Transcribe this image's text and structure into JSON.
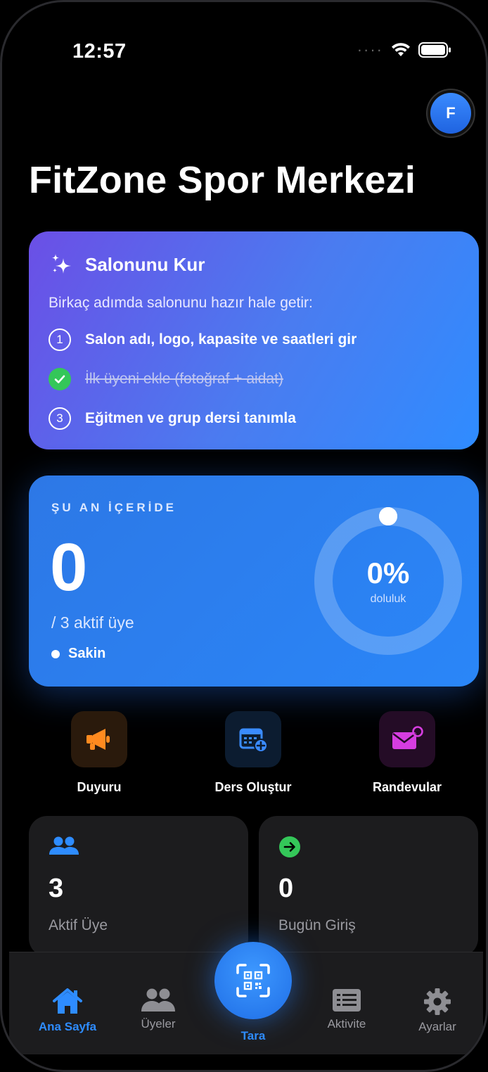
{
  "status": {
    "time": "12:57"
  },
  "avatar": {
    "initial": "F"
  },
  "page": {
    "title": "FitZone Spor Merkezi"
  },
  "setup": {
    "title": "Salonunu Kur",
    "description": "Birkaç adımda salonunu hazır hale getir:",
    "steps": [
      {
        "number": "1",
        "label": "Salon adı, logo, kapasite ve saatleri gir",
        "done": false
      },
      {
        "number": "2",
        "label": "İlk üyeni ekle (fotoğraf + aidat)",
        "done": true
      },
      {
        "number": "3",
        "label": "Eğitmen ve grup dersi tanımla",
        "done": false
      }
    ]
  },
  "occupancy": {
    "label": "ŞU AN İÇERİDE",
    "count": "0",
    "subtitle": "/ 3 aktif üye",
    "status": "Sakin",
    "percent_text": "0%",
    "percent_caption": "doluluk",
    "fill_percent": 0
  },
  "quick_actions": [
    {
      "label": "Duyuru",
      "icon": "megaphone-icon",
      "color": "#ff8a1f"
    },
    {
      "label": "Ders Oluştur",
      "icon": "calendar-add-icon",
      "color": "#3a8bff"
    },
    {
      "label": "Randevular",
      "icon": "envelope-badge-icon",
      "color": "#d63de0"
    }
  ],
  "stats": [
    {
      "value": "3",
      "label": "Aktif Üye",
      "icon": "people-icon",
      "color": "#2e8cff"
    },
    {
      "value": "0",
      "label": "Bugün Giriş",
      "icon": "arrow-right-circle-icon",
      "color": "#34c759"
    }
  ],
  "tabs": [
    {
      "label": "Ana Sayfa",
      "icon": "house-icon",
      "active": true
    },
    {
      "label": "Üyeler",
      "icon": "people-icon",
      "active": false
    },
    {
      "label": "Tara",
      "icon": "qr-scan-icon",
      "active": false
    },
    {
      "label": "Aktivite",
      "icon": "list-icon",
      "active": false
    },
    {
      "label": "Ayarlar",
      "icon": "gear-icon",
      "active": false
    }
  ],
  "colors": {
    "accent": "#2e8cff",
    "card_bg": "#1c1c1e"
  }
}
